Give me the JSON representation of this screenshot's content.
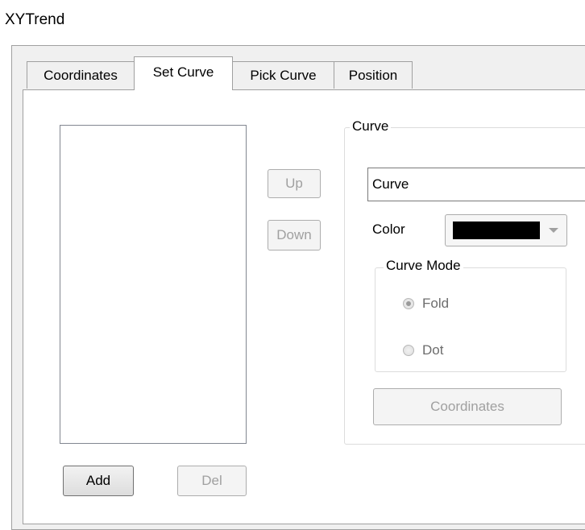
{
  "window": {
    "title": "XYTrend"
  },
  "tabs": [
    {
      "label": "Coordinates",
      "active": false
    },
    {
      "label": "Set Curve",
      "active": true
    },
    {
      "label": "Pick Curve",
      "active": false
    },
    {
      "label": "Position",
      "active": false
    }
  ],
  "set_curve": {
    "up_button": "Up",
    "down_button": "Down",
    "add_button": "Add",
    "del_button": "Del",
    "curve_group": {
      "legend": "Curve",
      "name_value": "Curve",
      "color_label": "Color",
      "color_value": "#000000",
      "mode_group": {
        "legend": "Curve Mode",
        "options": [
          {
            "label": "Fold",
            "checked": true
          },
          {
            "label": "Dot",
            "checked": false
          }
        ]
      },
      "coordinates_button": "Coordinates"
    }
  }
}
